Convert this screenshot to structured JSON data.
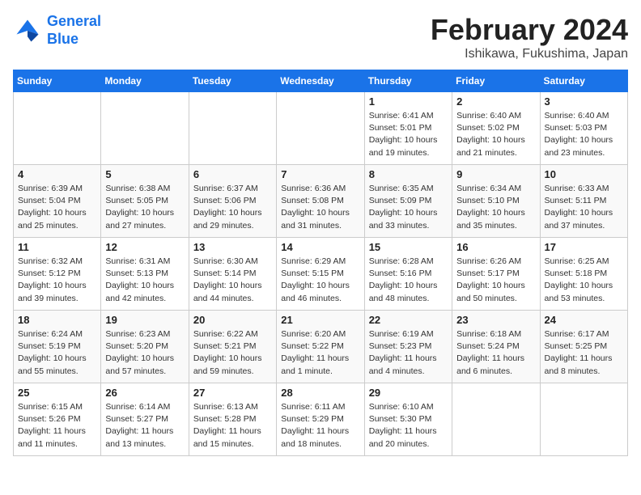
{
  "logo": {
    "line1": "General",
    "line2": "Blue"
  },
  "header": {
    "month": "February 2024",
    "location": "Ishikawa, Fukushima, Japan"
  },
  "weekdays": [
    "Sunday",
    "Monday",
    "Tuesday",
    "Wednesday",
    "Thursday",
    "Friday",
    "Saturday"
  ],
  "weeks": [
    [
      {
        "day": "",
        "info": ""
      },
      {
        "day": "",
        "info": ""
      },
      {
        "day": "",
        "info": ""
      },
      {
        "day": "",
        "info": ""
      },
      {
        "day": "1",
        "info": "Sunrise: 6:41 AM\nSunset: 5:01 PM\nDaylight: 10 hours\nand 19 minutes."
      },
      {
        "day": "2",
        "info": "Sunrise: 6:40 AM\nSunset: 5:02 PM\nDaylight: 10 hours\nand 21 minutes."
      },
      {
        "day": "3",
        "info": "Sunrise: 6:40 AM\nSunset: 5:03 PM\nDaylight: 10 hours\nand 23 minutes."
      }
    ],
    [
      {
        "day": "4",
        "info": "Sunrise: 6:39 AM\nSunset: 5:04 PM\nDaylight: 10 hours\nand 25 minutes."
      },
      {
        "day": "5",
        "info": "Sunrise: 6:38 AM\nSunset: 5:05 PM\nDaylight: 10 hours\nand 27 minutes."
      },
      {
        "day": "6",
        "info": "Sunrise: 6:37 AM\nSunset: 5:06 PM\nDaylight: 10 hours\nand 29 minutes."
      },
      {
        "day": "7",
        "info": "Sunrise: 6:36 AM\nSunset: 5:08 PM\nDaylight: 10 hours\nand 31 minutes."
      },
      {
        "day": "8",
        "info": "Sunrise: 6:35 AM\nSunset: 5:09 PM\nDaylight: 10 hours\nand 33 minutes."
      },
      {
        "day": "9",
        "info": "Sunrise: 6:34 AM\nSunset: 5:10 PM\nDaylight: 10 hours\nand 35 minutes."
      },
      {
        "day": "10",
        "info": "Sunrise: 6:33 AM\nSunset: 5:11 PM\nDaylight: 10 hours\nand 37 minutes."
      }
    ],
    [
      {
        "day": "11",
        "info": "Sunrise: 6:32 AM\nSunset: 5:12 PM\nDaylight: 10 hours\nand 39 minutes."
      },
      {
        "day": "12",
        "info": "Sunrise: 6:31 AM\nSunset: 5:13 PM\nDaylight: 10 hours\nand 42 minutes."
      },
      {
        "day": "13",
        "info": "Sunrise: 6:30 AM\nSunset: 5:14 PM\nDaylight: 10 hours\nand 44 minutes."
      },
      {
        "day": "14",
        "info": "Sunrise: 6:29 AM\nSunset: 5:15 PM\nDaylight: 10 hours\nand 46 minutes."
      },
      {
        "day": "15",
        "info": "Sunrise: 6:28 AM\nSunset: 5:16 PM\nDaylight: 10 hours\nand 48 minutes."
      },
      {
        "day": "16",
        "info": "Sunrise: 6:26 AM\nSunset: 5:17 PM\nDaylight: 10 hours\nand 50 minutes."
      },
      {
        "day": "17",
        "info": "Sunrise: 6:25 AM\nSunset: 5:18 PM\nDaylight: 10 hours\nand 53 minutes."
      }
    ],
    [
      {
        "day": "18",
        "info": "Sunrise: 6:24 AM\nSunset: 5:19 PM\nDaylight: 10 hours\nand 55 minutes."
      },
      {
        "day": "19",
        "info": "Sunrise: 6:23 AM\nSunset: 5:20 PM\nDaylight: 10 hours\nand 57 minutes."
      },
      {
        "day": "20",
        "info": "Sunrise: 6:22 AM\nSunset: 5:21 PM\nDaylight: 10 hours\nand 59 minutes."
      },
      {
        "day": "21",
        "info": "Sunrise: 6:20 AM\nSunset: 5:22 PM\nDaylight: 11 hours\nand 1 minute."
      },
      {
        "day": "22",
        "info": "Sunrise: 6:19 AM\nSunset: 5:23 PM\nDaylight: 11 hours\nand 4 minutes."
      },
      {
        "day": "23",
        "info": "Sunrise: 6:18 AM\nSunset: 5:24 PM\nDaylight: 11 hours\nand 6 minutes."
      },
      {
        "day": "24",
        "info": "Sunrise: 6:17 AM\nSunset: 5:25 PM\nDaylight: 11 hours\nand 8 minutes."
      }
    ],
    [
      {
        "day": "25",
        "info": "Sunrise: 6:15 AM\nSunset: 5:26 PM\nDaylight: 11 hours\nand 11 minutes."
      },
      {
        "day": "26",
        "info": "Sunrise: 6:14 AM\nSunset: 5:27 PM\nDaylight: 11 hours\nand 13 minutes."
      },
      {
        "day": "27",
        "info": "Sunrise: 6:13 AM\nSunset: 5:28 PM\nDaylight: 11 hours\nand 15 minutes."
      },
      {
        "day": "28",
        "info": "Sunrise: 6:11 AM\nSunset: 5:29 PM\nDaylight: 11 hours\nand 18 minutes."
      },
      {
        "day": "29",
        "info": "Sunrise: 6:10 AM\nSunset: 5:30 PM\nDaylight: 11 hours\nand 20 minutes."
      },
      {
        "day": "",
        "info": ""
      },
      {
        "day": "",
        "info": ""
      }
    ]
  ]
}
